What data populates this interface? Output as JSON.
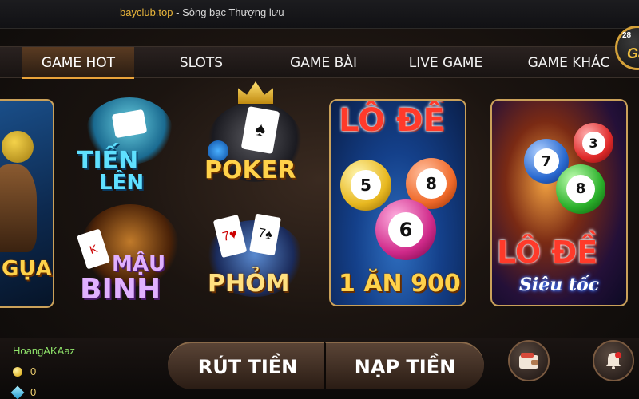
{
  "topbar": {
    "site": "bayclub.top",
    "separator": " - ",
    "tagline": "Sòng bạc Thượng lưu"
  },
  "nav": {
    "tabs": [
      {
        "label": "GAME HOT",
        "active": true
      },
      {
        "label": "SLOTS",
        "active": false
      },
      {
        "label": "GAME BÀI",
        "active": false
      },
      {
        "label": "LIVE GAME",
        "active": false
      },
      {
        "label": "GAME KHÁC",
        "active": false
      }
    ]
  },
  "logo": {
    "number": "28",
    "mark": "Ga"
  },
  "games": {
    "horse": {
      "label": "GỤA"
    },
    "tien_len": {
      "line1": "TIẾN",
      "line2": "LÊN"
    },
    "poker": {
      "label": "POKER"
    },
    "mau_binh": {
      "line1": "MẬU",
      "line2": "BINH"
    },
    "phom": {
      "label": "PHỎM"
    },
    "lode": {
      "title": "LÔ ĐỀ",
      "balls": [
        "5",
        "8",
        "6"
      ],
      "caption": "1 ĂN 900"
    },
    "lode_sieutoc": {
      "balls": [
        "7",
        "3",
        "8"
      ],
      "title": "LÔ ĐỀ",
      "subtitle": "Siêu tốc"
    }
  },
  "user": {
    "name": "HoangAKAaz",
    "gold": "0",
    "gems": "0"
  },
  "bottom": {
    "withdraw": "RÚT TIỀN",
    "deposit": "NẠP TIỀN"
  },
  "colors": {
    "accent": "#e9a33a",
    "username": "#8fe36a",
    "site": "#e9b53a"
  }
}
